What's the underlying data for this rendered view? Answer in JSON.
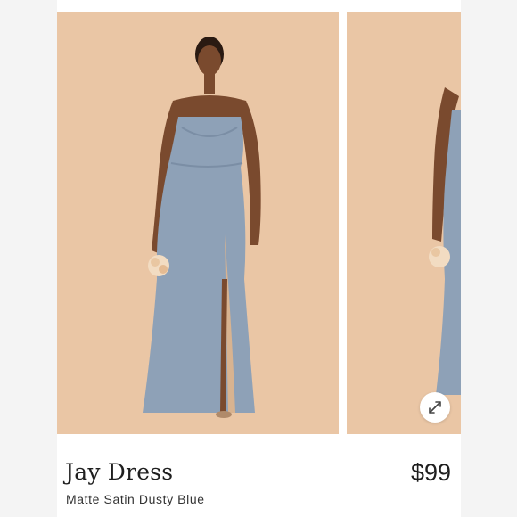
{
  "product": {
    "name": "Jay Dress",
    "variant": "Matte Satin Dusty Blue",
    "price": "$99"
  },
  "gallery": {
    "expand_icon": "expand-arrows-icon"
  },
  "colors": {
    "backdrop": "#eac6a5",
    "dress": "#8ea1b7",
    "side_strip": "#f4f4f4"
  }
}
